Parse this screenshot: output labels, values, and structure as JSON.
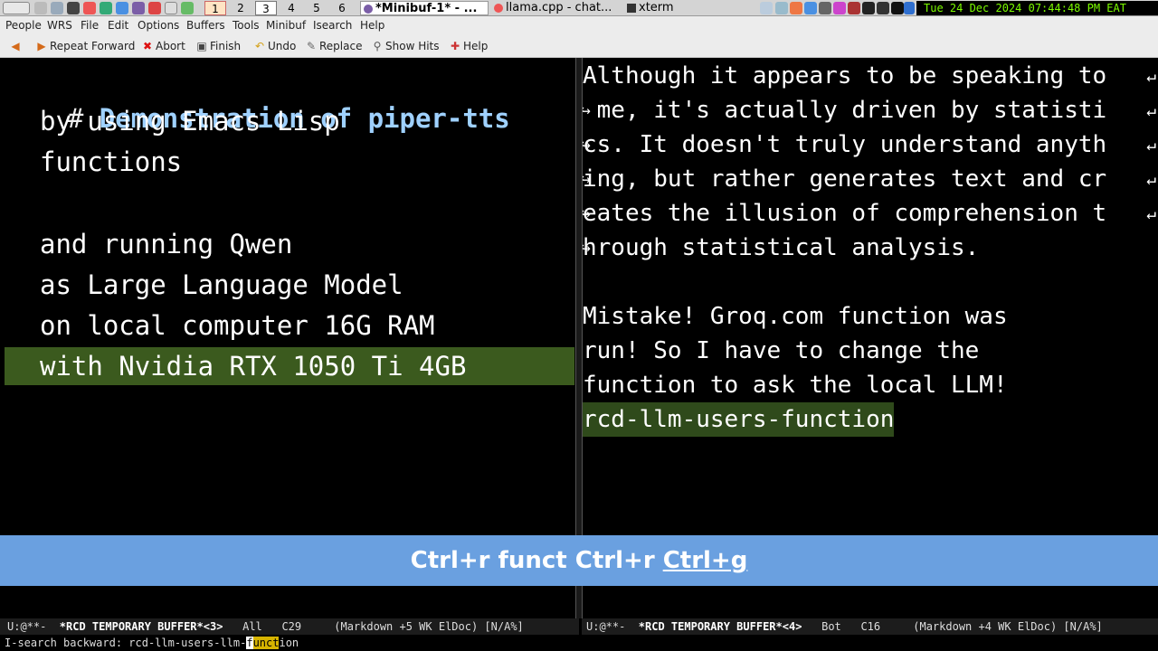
{
  "taskbar": {
    "workspaces": [
      "1",
      "2",
      "3",
      "4",
      "5",
      "6"
    ],
    "windows": [
      {
        "title": "*Minibuf-1* - ...",
        "active": true
      },
      {
        "title": "llama.cpp - chat...",
        "active": false
      },
      {
        "title": "xterm",
        "active": false
      }
    ],
    "clock": "Tue 24 Dec 2024 07:44:48 PM EAT"
  },
  "menubar": {
    "items": [
      "People",
      "WRS",
      "File",
      "Edit",
      "Options",
      "Buffers",
      "Tools",
      "Minibuf",
      "Isearch",
      "Help"
    ]
  },
  "toolbar": {
    "items": [
      {
        "label": "",
        "icon": "back-arrow-icon"
      },
      {
        "label": "Repeat Forward",
        "icon": "forward-arrow-icon"
      },
      {
        "label": "Abort",
        "icon": "abort-x-icon"
      },
      {
        "label": "Finish",
        "icon": "finish-icon"
      },
      {
        "label": "Undo",
        "icon": "undo-icon"
      },
      {
        "label": "Replace",
        "icon": "replace-icon"
      },
      {
        "label": "Show Hits",
        "icon": "magnifier-icon"
      },
      {
        "label": "Help",
        "icon": "help-icon"
      }
    ]
  },
  "left_pane": {
    "heading_hash": "#",
    "heading_text": "Demonstration of piper-tts",
    "lines": [
      "by using Emacs Lisp",
      "functions",
      "",
      "and running Qwen",
      "as Large Language Model",
      "on local computer 16G RAM"
    ],
    "highlighted_line": "with Nvidia RTX 1050 Ti 4GB"
  },
  "right_pane": {
    "wrapped_lines": [
      "Although it appears to be speaking to",
      " me, it's actually driven by statisti",
      "cs. It doesn't truly understand anyth",
      "ing, but rather generates text and cr",
      "eates the illusion of comprehension t",
      "hrough statistical analysis."
    ],
    "para2": [
      "Mistake! Groq.com function was",
      "run! So I have to change the",
      "function to ask the local LLM!"
    ],
    "highlighted_line": "rcd-llm-users-function"
  },
  "key_overlay": {
    "plain": "Ctrl+r funct Ctrl+r ",
    "underlined": "Ctrl+g"
  },
  "modeline_left": {
    "status": "U:@**-  ",
    "buffer": "*RCD TEMPORARY BUFFER*<3>",
    "position": "   All   C29     ",
    "mode": "(Markdown +5 WK ElDoc) [N/A%]"
  },
  "modeline_right": {
    "status": "U:@**-  ",
    "buffer": "*RCD TEMPORARY BUFFER*<4>",
    "position": "   Bot   C16     ",
    "mode": "(Markdown +4 WK ElDoc) [N/A%]"
  },
  "minibuffer": {
    "prompt": "I-search backward: ",
    "before": "rcd-llm-users-llm-",
    "cursor_char": "f",
    "match_rest": "unct",
    "after": "ion"
  },
  "colors": {
    "highlight_left": "#3b5a1e",
    "highlight_right": "#2f4a1b",
    "heading": "#9fd1ff",
    "overlay": "#6aa0e0",
    "clock_fg": "#7cfc00"
  }
}
